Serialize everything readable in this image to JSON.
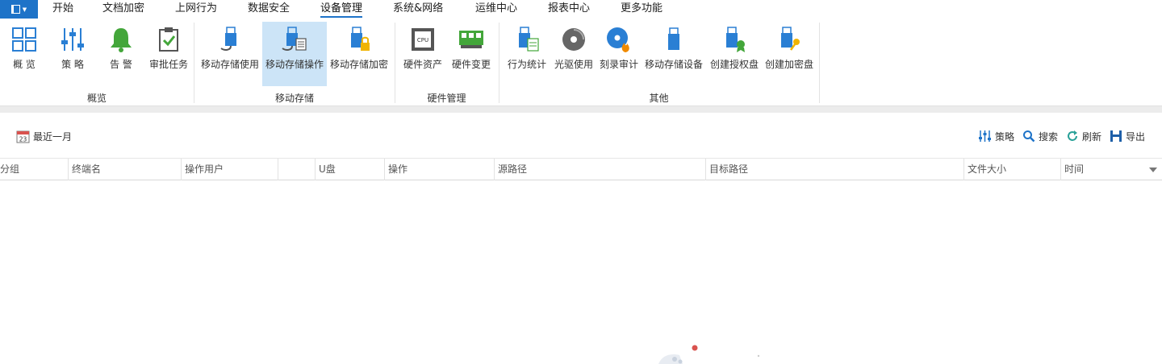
{
  "menu": {
    "items": [
      "开始",
      "文档加密",
      "上网行为",
      "数据安全",
      "设备管理",
      "系统&网络",
      "运维中心",
      "报表中心",
      "更多功能"
    ],
    "active": "设备管理"
  },
  "ribbon": {
    "groups": [
      {
        "label": "概览",
        "buttons": [
          "概 览",
          "策 略",
          "告 警",
          "审批任务"
        ]
      },
      {
        "label": "移动存储",
        "buttons": [
          "移动存储使用",
          "移动存储操作",
          "移动存储加密"
        ]
      },
      {
        "label": "硬件管理",
        "buttons": [
          "硬件资产",
          "硬件变更"
        ]
      },
      {
        "label": "其他",
        "buttons": [
          "行为统计",
          "光驱使用",
          "刻录审计",
          "移动存储设备",
          "创建授权盘",
          "创建加密盘"
        ]
      }
    ],
    "selected_button": "移动存储操作",
    "cpu_chip_text": "CPU",
    "accent_color": "#1e73c8"
  },
  "toolbar": {
    "date_filter": "最近一月",
    "calendar_day": "23",
    "strategy": "策略",
    "search": "搜索",
    "refresh": "刷新",
    "export": "导出"
  },
  "table": {
    "columns": [
      "分组",
      "终端名",
      "操作用户",
      "",
      "U盘",
      "操作",
      "源路径",
      "目标路径",
      "文件大小",
      "时间"
    ]
  }
}
